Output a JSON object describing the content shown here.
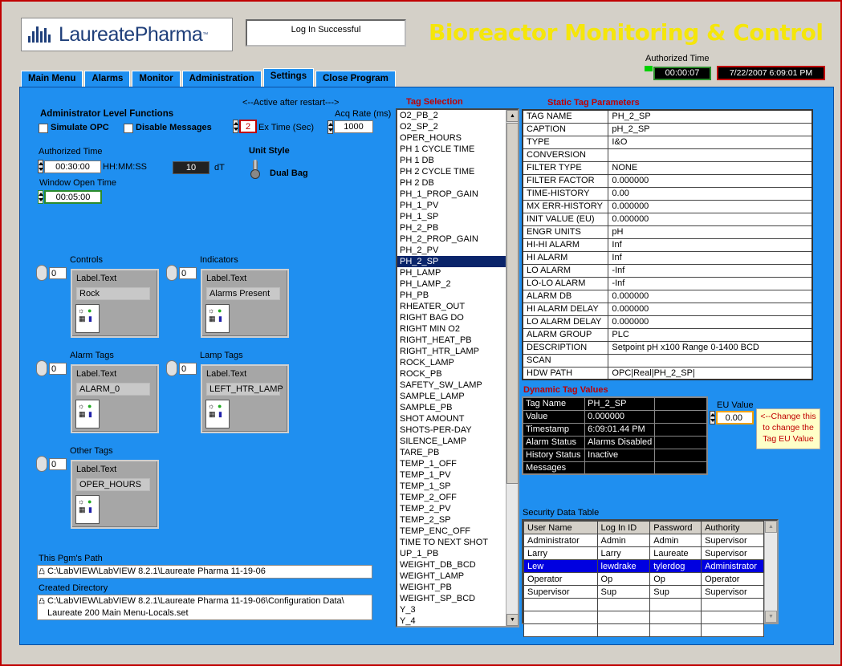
{
  "header": {
    "logo_text": "LaureatePharma",
    "logo_tm": "™",
    "login_status": "Log In Successful",
    "title": "Bioreactor Monitoring & Control",
    "authorized_time_label": "Authorized Time",
    "authorized_time_value": "00:00:07",
    "datetime": "7/22/2007 6:09:01 PM"
  },
  "tabs": [
    "Main Menu",
    "Alarms",
    "Monitor",
    "Administration",
    "Settings",
    "Close Program"
  ],
  "active_tab": "Settings",
  "settings": {
    "active_after_restart": "<--Active after restart--->",
    "admin_functions_label": "Administrator Level Functions",
    "simulate_opc": "Simulate OPC",
    "disable_messages": "Disable Messages",
    "ex_time_value": "2",
    "ex_time_label": "Ex Time (Sec)",
    "acq_rate_label": "Acq Rate (ms)",
    "acq_rate_value": "1000",
    "authorized_time_label": "Authorized Time",
    "authorized_time_value": "00:30:00",
    "hhmmss": "HH:MM:SS",
    "dt_value": "10",
    "dt_label": "dT",
    "window_open_label": "Window Open Time",
    "window_open_value": "00:05:00",
    "unit_style_label": "Unit Style",
    "unit_style_value": "Dual Bag"
  },
  "clusters": [
    {
      "group": "Controls",
      "index": "0",
      "title": "Label.Text",
      "value": "Rock"
    },
    {
      "group": "Indicators",
      "index": "0",
      "title": "Label.Text",
      "value": "Alarms Present"
    },
    {
      "group": "Alarm Tags",
      "index": "0",
      "title": "Label.Text",
      "value": "ALARM_0"
    },
    {
      "group": "Lamp Tags",
      "index": "0",
      "title": "Label.Text",
      "value": "LEFT_HTR_LAMP"
    },
    {
      "group": "Other Tags",
      "index": "0",
      "title": "Label.Text",
      "value": "OPER_HOURS"
    }
  ],
  "paths": {
    "pgm_label": "This Pgm's Path",
    "pgm_value": "C:\\LabVIEW\\LabVIEW 8.2.1\\Laureate Pharma 11-19-06",
    "created_label": "Created Directory",
    "created_line1": "C:\\LabVIEW\\LabVIEW 8.2.1\\Laureate Pharma 11-19-06\\Configuration Data\\",
    "created_line2": "Laureate 200 Main Menu-Locals.set"
  },
  "tag_selection": {
    "title": "Tag Selection",
    "items": [
      "O2_PB_2",
      "O2_SP_2",
      "OPER_HOURS",
      "PH 1 CYCLE TIME",
      "PH 1 DB",
      "PH 2 CYCLE TIME",
      "PH 2 DB",
      "PH_1_PROP_GAIN",
      "PH_1_PV",
      "PH_1_SP",
      "PH_2_PB",
      "PH_2_PROP_GAIN",
      "PH_2_PV",
      "PH_2_SP",
      "PH_LAMP",
      "PH_LAMP_2",
      "PH_PB",
      "RHEATER_OUT",
      "RIGHT BAG DO",
      "RIGHT MIN O2",
      "RIGHT_HEAT_PB",
      "RIGHT_HTR_LAMP",
      "ROCK_LAMP",
      "ROCK_PB",
      "SAFETY_SW_LAMP",
      "SAMPLE_LAMP",
      "SAMPLE_PB",
      "SHOT AMOUNT",
      "SHOTS-PER-DAY",
      "SILENCE_LAMP",
      "TARE_PB",
      "TEMP_1_OFF",
      "TEMP_1_PV",
      "TEMP_1_SP",
      "TEMP_2_OFF",
      "TEMP_2_PV",
      "TEMP_2_SP",
      "TEMP_ENC_OFF",
      "TIME TO NEXT SHOT",
      "UP_1_PB",
      "WEIGHT_DB_BCD",
      "WEIGHT_LAMP",
      "WEIGHT_PB",
      "WEIGHT_SP_BCD",
      "Y_3",
      "Y_4"
    ],
    "selected": "PH_2_SP"
  },
  "static_params": {
    "title": "Static Tag Parameters",
    "rows": [
      [
        "TAG NAME",
        "PH_2_SP"
      ],
      [
        "CAPTION",
        "pH_2_SP"
      ],
      [
        "TYPE",
        "I&O"
      ],
      [
        "CONVERSION",
        ""
      ],
      [
        "FILTER TYPE",
        "NONE"
      ],
      [
        "FILTER FACTOR",
        "0.000000"
      ],
      [
        "TIME-HISTORY",
        "0.00"
      ],
      [
        "MX ERR-HISTORY",
        "0.000000"
      ],
      [
        "INIT VALUE (EU)",
        "0.000000"
      ],
      [
        "ENGR UNITS",
        "pH"
      ],
      [
        "HI-HI ALARM",
        "Inf"
      ],
      [
        "HI ALARM",
        "Inf"
      ],
      [
        "LO ALARM",
        "-Inf"
      ],
      [
        "LO-LO ALARM",
        "-Inf"
      ],
      [
        "ALARM DB",
        "0.000000"
      ],
      [
        "HI ALARM DELAY",
        "0.000000"
      ],
      [
        "LO ALARM DELAY",
        "0.000000"
      ],
      [
        "ALARM GROUP",
        "PLC"
      ],
      [
        "DESCRIPTION",
        "Setpoint pH  x100 Range 0-1400  BCD"
      ],
      [
        "SCAN",
        ""
      ],
      [
        "HDW PATH",
        "OPC|Real|PH_2_SP|"
      ]
    ]
  },
  "dynamic_values": {
    "title": "Dynamic Tag Values",
    "rows": [
      [
        "Tag Name",
        "PH_2_SP",
        ""
      ],
      [
        "Value",
        "0.000000",
        ""
      ],
      [
        "Timestamp",
        "6:09:01.44 PM",
        ""
      ],
      [
        "Alarm Status",
        "Alarms Disabled",
        ""
      ],
      [
        "History Status",
        "Inactive",
        ""
      ],
      [
        "Messages",
        "",
        ""
      ]
    ],
    "eu_label": "EU Value",
    "eu_value": "0.00",
    "note": "<--Change this to change the Tag EU Value"
  },
  "security": {
    "title": "Security Data Table",
    "headers": [
      "User Name",
      "Log In ID",
      "Password",
      "Authority"
    ],
    "rows": [
      [
        "Administrator",
        "Admin",
        "Admin",
        "Supervisor"
      ],
      [
        "Larry",
        "Larry",
        "Laureate",
        "Supervisor"
      ],
      [
        "Lew",
        "lewdrake",
        "tylerdog",
        "Administrator"
      ],
      [
        "Operator",
        "Op",
        "Op",
        "Operator"
      ],
      [
        "Supervisor",
        "Sup",
        "Sup",
        "Supervisor"
      ],
      [
        "",
        "",
        "",
        ""
      ],
      [
        "",
        "",
        "",
        ""
      ],
      [
        "",
        "",
        "",
        ""
      ]
    ],
    "selected_row": 2
  }
}
